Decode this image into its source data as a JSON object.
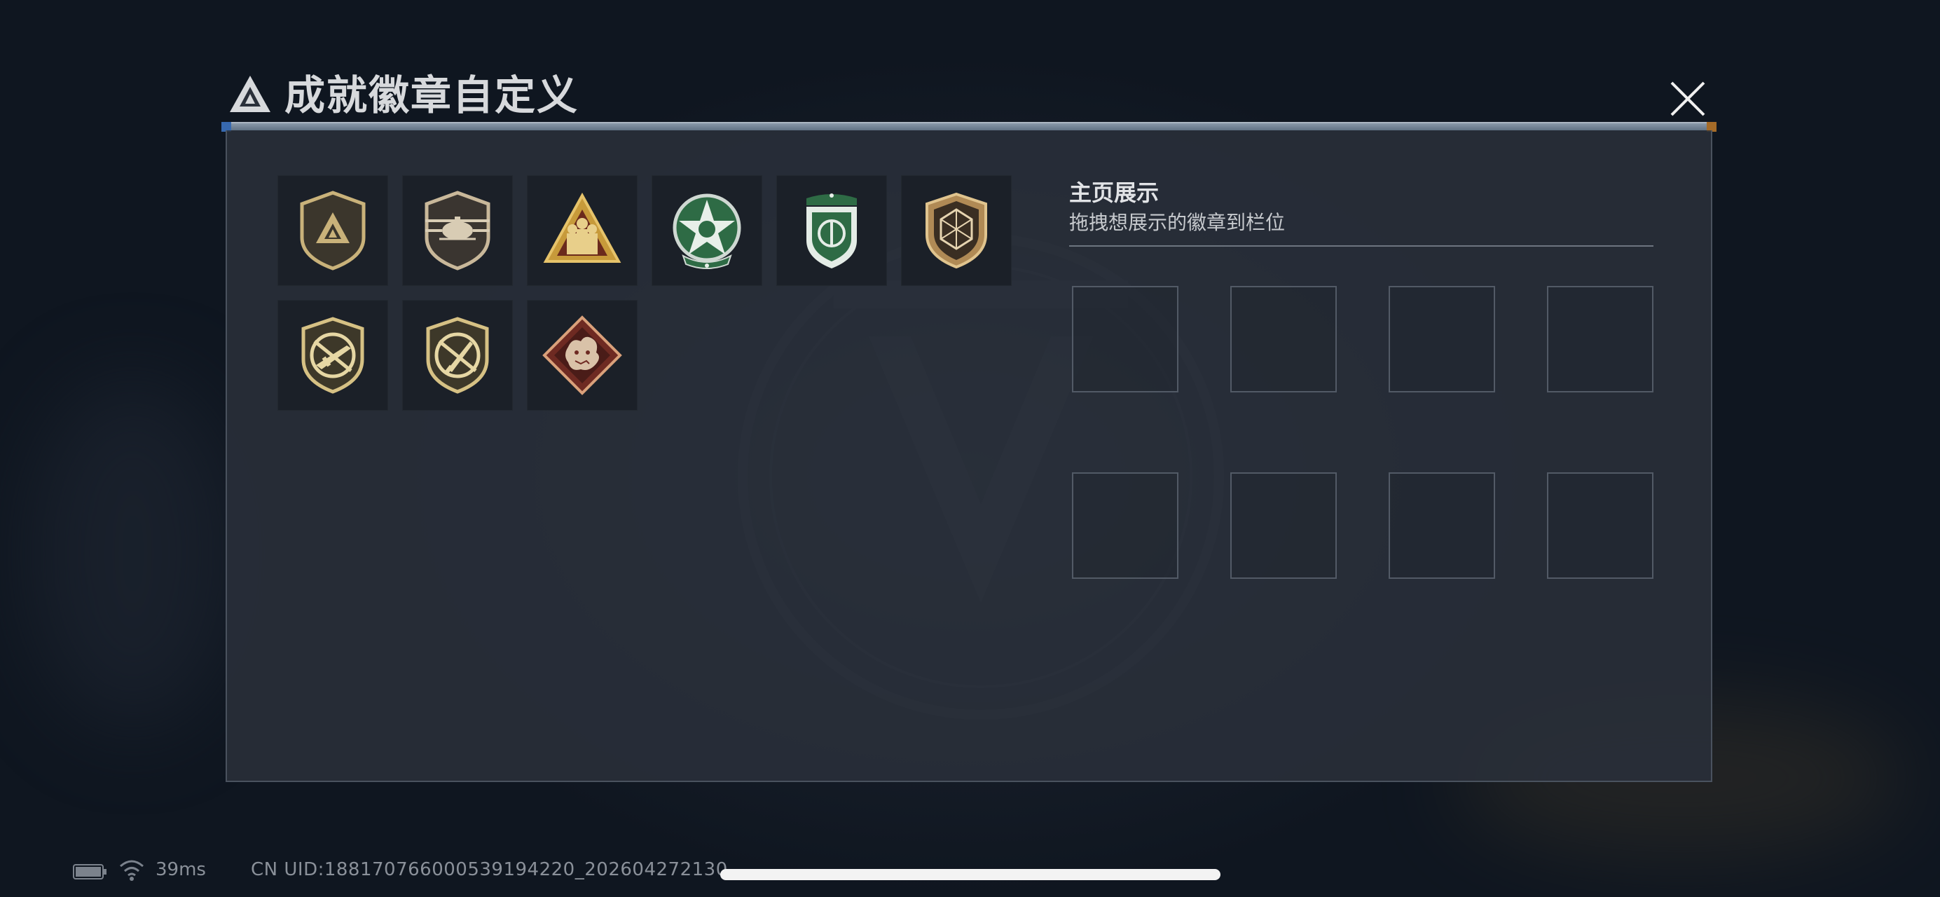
{
  "header": {
    "title": "成就徽章自定义",
    "logo_icon": "triangle-emblem-icon",
    "close_icon": "close-icon"
  },
  "badges": [
    {
      "name": "triangle-emblem-badge",
      "icon": "triangle-logo-shield"
    },
    {
      "name": "helicopter-badge",
      "icon": "helicopter-shield"
    },
    {
      "name": "soldiers-badge",
      "icon": "soldiers-triangle"
    },
    {
      "name": "green-star-badge",
      "icon": "green-star-circle"
    },
    {
      "name": "green-shield-badge",
      "icon": "green-shield"
    },
    {
      "name": "gem-badge",
      "icon": "d20-gem-shield"
    },
    {
      "name": "rifle-badge",
      "icon": "rifle-shield"
    },
    {
      "name": "knife-badge",
      "icon": "knife-shield"
    },
    {
      "name": "dragon-badge",
      "icon": "dragon-diamond"
    }
  ],
  "showcase": {
    "title": "主页展示",
    "subtitle": "拖拽想展示的徽章到栏位",
    "slot_count": 8
  },
  "status_bar": {
    "ping": "39ms",
    "uid": "CN UID:18817076600053919422​0_202604272130",
    "battery_icon": "battery-icon",
    "wifi_icon": "wifi-icon"
  },
  "colors": {
    "panel": "#2a303a",
    "badge_cell": "#1b2028",
    "gold": "#c9b27a",
    "green": "#2e6b45",
    "header_bar": "#9fb0c2"
  }
}
